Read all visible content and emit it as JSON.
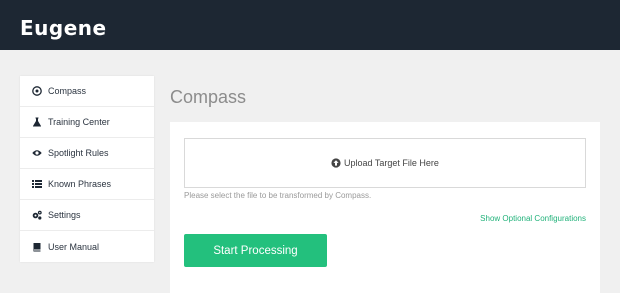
{
  "header": {
    "logo_text": "Eugene"
  },
  "sidebar": {
    "items": [
      {
        "label": "Compass",
        "icon": "compass-icon"
      },
      {
        "label": "Training Center",
        "icon": "flask-icon"
      },
      {
        "label": "Spotlight Rules",
        "icon": "eye-icon"
      },
      {
        "label": "Known Phrases",
        "icon": "list-icon"
      },
      {
        "label": "Settings",
        "icon": "gears-icon"
      },
      {
        "label": "User Manual",
        "icon": "book-icon"
      }
    ]
  },
  "main": {
    "title": "Compass",
    "upload_label": "Upload Target File Here",
    "upload_icon": "upload-circle-icon",
    "help_text": "Please select the file to be transformed by Compass.",
    "optional_link": "Show Optional Configurations",
    "start_button": "Start Processing"
  },
  "colors": {
    "topbar": "#1d2733",
    "accent": "#23c07d",
    "link": "#21b27a",
    "background": "#f0f0f0"
  }
}
